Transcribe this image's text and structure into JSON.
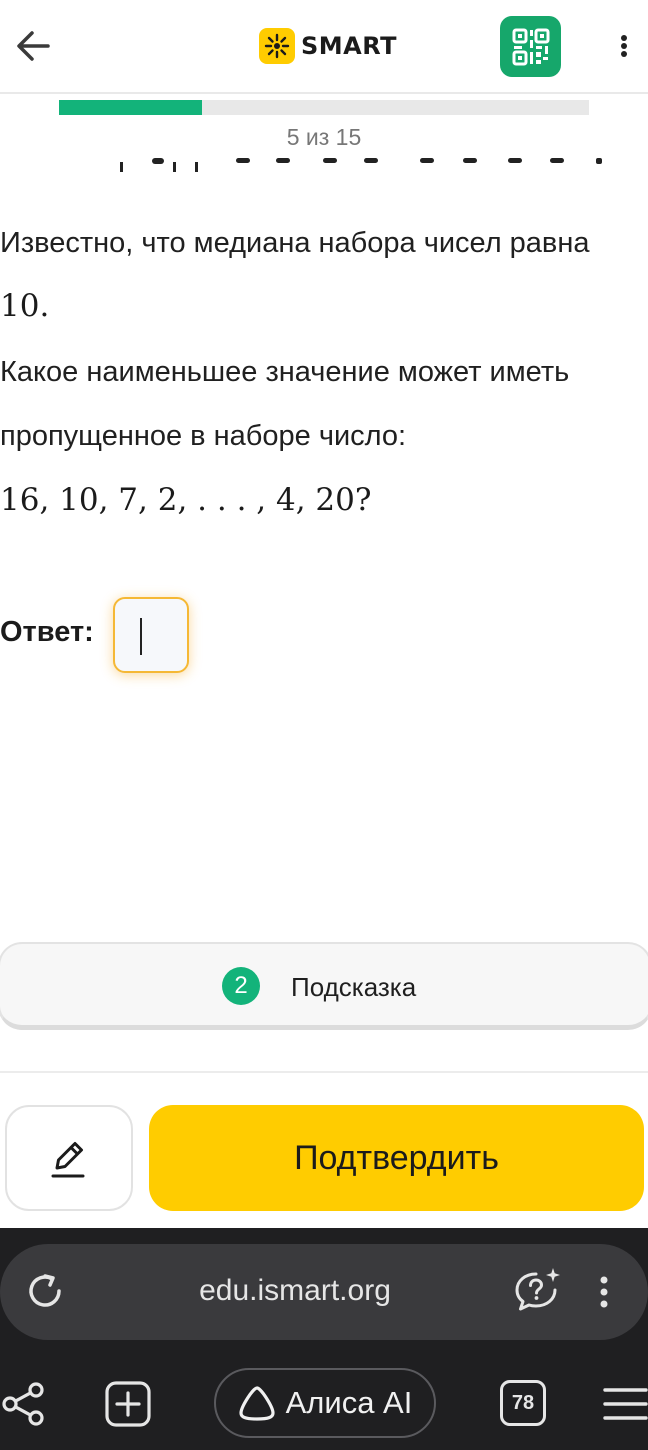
{
  "header": {
    "brand_name": "SMART",
    "back_icon": "arrow-left-icon",
    "qr_icon": "qr-code-icon",
    "menu_icon": "more-vertical-icon"
  },
  "progress": {
    "current": 5,
    "total": 15,
    "label": "5 из 15",
    "fill_fraction": 0.27
  },
  "question": {
    "line1": "Известно, что медиана набора чисел равна",
    "line2": "10.",
    "line3": "Какое наименьшее значение может иметь",
    "line4": "пропущенное в наборе число:",
    "line5": "16,  10,  7,  2,  . . . ,  4,  20?"
  },
  "answer": {
    "label": "Ответ:",
    "value": ""
  },
  "hint": {
    "count": "2",
    "label": "Подсказка"
  },
  "actions": {
    "edit_icon": "pencil-icon",
    "confirm_label": "Подтвердить"
  },
  "browser": {
    "url": "edu.ismart.org",
    "alisa_label": "Алиса AI",
    "tabs_count": "78"
  },
  "colors": {
    "accent_green": "#13b37a",
    "brand_yellow": "#ffcc00",
    "focus_orange": "#f5b835",
    "browser_bg": "#1f1f21"
  }
}
